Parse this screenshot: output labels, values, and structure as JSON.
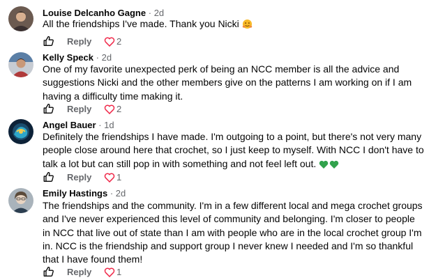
{
  "comments": [
    {
      "author": "Louise Delcanho Gagne",
      "separator": "·",
      "time": "2d",
      "text": "All the friendships I've made. Thank you Nicki",
      "emoji": "hugging-face-emoji",
      "reply_label": "Reply",
      "reaction_icon": "heart-icon",
      "reaction_count": "2",
      "avatar_colors": [
        "#5a4a42",
        "#c9a48a"
      ]
    },
    {
      "author": "Kelly Speck",
      "separator": "·",
      "time": "2d",
      "text": "One of my favorite unexpected perk of being an NCC member is all the advice and suggestions Nicki and the other members give on the patterns I am working on if I am having a difficulty time making it.",
      "reply_label": "Reply",
      "reaction_icon": "heart-icon",
      "reaction_count": "2",
      "avatar_colors": [
        "#3b5f8a",
        "#b03a3a"
      ]
    },
    {
      "author": "Angel Bauer",
      "separator": "·",
      "time": "1d",
      "text": "Definitely the friendships I have made. I'm outgoing to a point, but there's not very many people close around here that crochet, so I just keep to myself. With NCC I don't have to talk a lot but can still pop in with something and not feel left out.",
      "emoji": "green-heart-emoji",
      "reply_label": "Reply",
      "reaction_icon": "heart-icon",
      "reaction_count": "1",
      "avatar_colors": [
        "#0d2238",
        "#2ea6c9"
      ]
    },
    {
      "author": "Emily Hastings",
      "separator": "·",
      "time": "2d",
      "text": "The friendships and the community. I'm in a few different local and mega crochet groups and I've never experienced this level of community and belonging. I'm closer to people in NCC that live out of state than I am with people who are in the local crochet group I'm in. NCC is the friendship and support group I never knew I needed and I'm so thankful that I have found them!",
      "reply_label": "Reply",
      "reaction_icon": "heart-icon",
      "reaction_count": "1",
      "avatar_colors": [
        "#7a8a96",
        "#e8d4c2"
      ]
    }
  ],
  "colors": {
    "text_primary": "#050505",
    "text_secondary": "#65676b",
    "heart_red": "#f02849",
    "emoji_green": "#31a24c",
    "emoji_yellow": "#f7b928"
  }
}
